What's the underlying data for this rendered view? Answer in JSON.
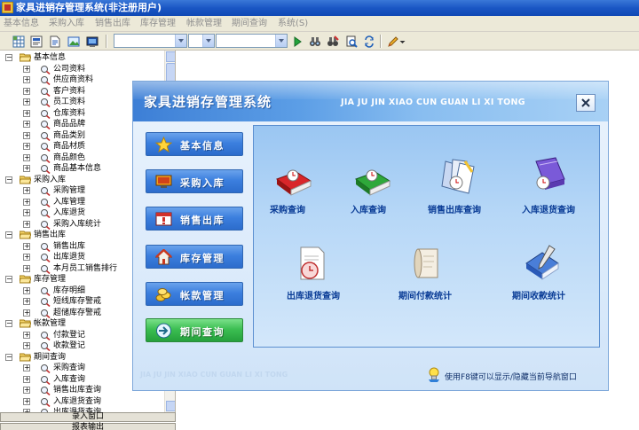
{
  "window": {
    "title": "家具进销存管理系统(非注册用户)"
  },
  "menu": [
    "基本信息",
    "采购入库",
    "销售出库",
    "库存管理",
    "帐款管理",
    "期间查询",
    "系统(S)"
  ],
  "toolbar": {
    "buttons": [
      "grid-icon",
      "form-icon",
      "document-icon",
      "image-icon",
      "screen-icon"
    ],
    "combos": [
      "",
      "",
      ""
    ],
    "actions": [
      "play-icon",
      "binoculars-icon",
      "binoculars-edit-icon",
      "preview-icon",
      "refresh-icon",
      "pen-icon"
    ]
  },
  "tree": {
    "groups": [
      {
        "label": "基本信息",
        "items": [
          "公司资料",
          "供应商资料",
          "客户资料",
          "员工资料",
          "仓库资料",
          "商品品牌",
          "商品类别",
          "商品材质",
          "商品颜色",
          "商品基本信息"
        ]
      },
      {
        "label": "采购入库",
        "items": [
          "采购管理",
          "入库管理",
          "入库退货",
          "采购入库统计"
        ]
      },
      {
        "label": "销售出库",
        "items": [
          "销售出库",
          "出库退货",
          "本月员工销售排行"
        ]
      },
      {
        "label": "库存管理",
        "items": [
          "库存明细",
          "短线库存警戒",
          "超储库存警戒"
        ]
      },
      {
        "label": "帐款管理",
        "items": [
          "付款登记",
          "收款登记"
        ]
      },
      {
        "label": "期间查询",
        "items": [
          "采购查询",
          "入库查询",
          "销售出库查询",
          "入库退货查询",
          "出库退货查询"
        ]
      }
    ]
  },
  "bottom_buttons": [
    "录入窗口",
    "报表输出"
  ],
  "dialog": {
    "title": "家具进销存管理系统",
    "pinyin": "JIA JU JIN XIAO CUN  GUAN LI XI TONG",
    "footer_pinyin": "JIA JU JIN XIAO CUN GUAN LI XI TONG",
    "hint": "使用F8键可以显示/隐藏当前导航窗口",
    "nav": [
      {
        "label": "基本信息",
        "icon": "star-icon"
      },
      {
        "label": "采购入库",
        "icon": "monitor-icon"
      },
      {
        "label": "销售出库",
        "icon": "alert-window-icon"
      },
      {
        "label": "库存管理",
        "icon": "house-icon"
      },
      {
        "label": "帐款管理",
        "icon": "coins-icon"
      },
      {
        "label": "期间查询",
        "icon": "arrow-icon"
      }
    ],
    "modules": [
      {
        "label": "采购查询",
        "icon": "red-book-clock-icon"
      },
      {
        "label": "入库查询",
        "icon": "green-book-clock-icon"
      },
      {
        "label": "销售出库查询",
        "icon": "files-clock-icon"
      },
      {
        "label": "入库退货查询",
        "icon": "purple-book-clock-icon"
      },
      {
        "label": "出库退货查询",
        "icon": "document-clock-icon"
      },
      {
        "label": "期间付款统计",
        "icon": "scroll-icon"
      },
      {
        "label": "期间收款统计",
        "icon": "blue-book-pen-icon"
      }
    ]
  },
  "colors": {
    "titlebar": "#1a56c4",
    "accent_blue": "#3c7fde",
    "accent_green": "#3cbf52",
    "module_text": "#0a3c96"
  }
}
